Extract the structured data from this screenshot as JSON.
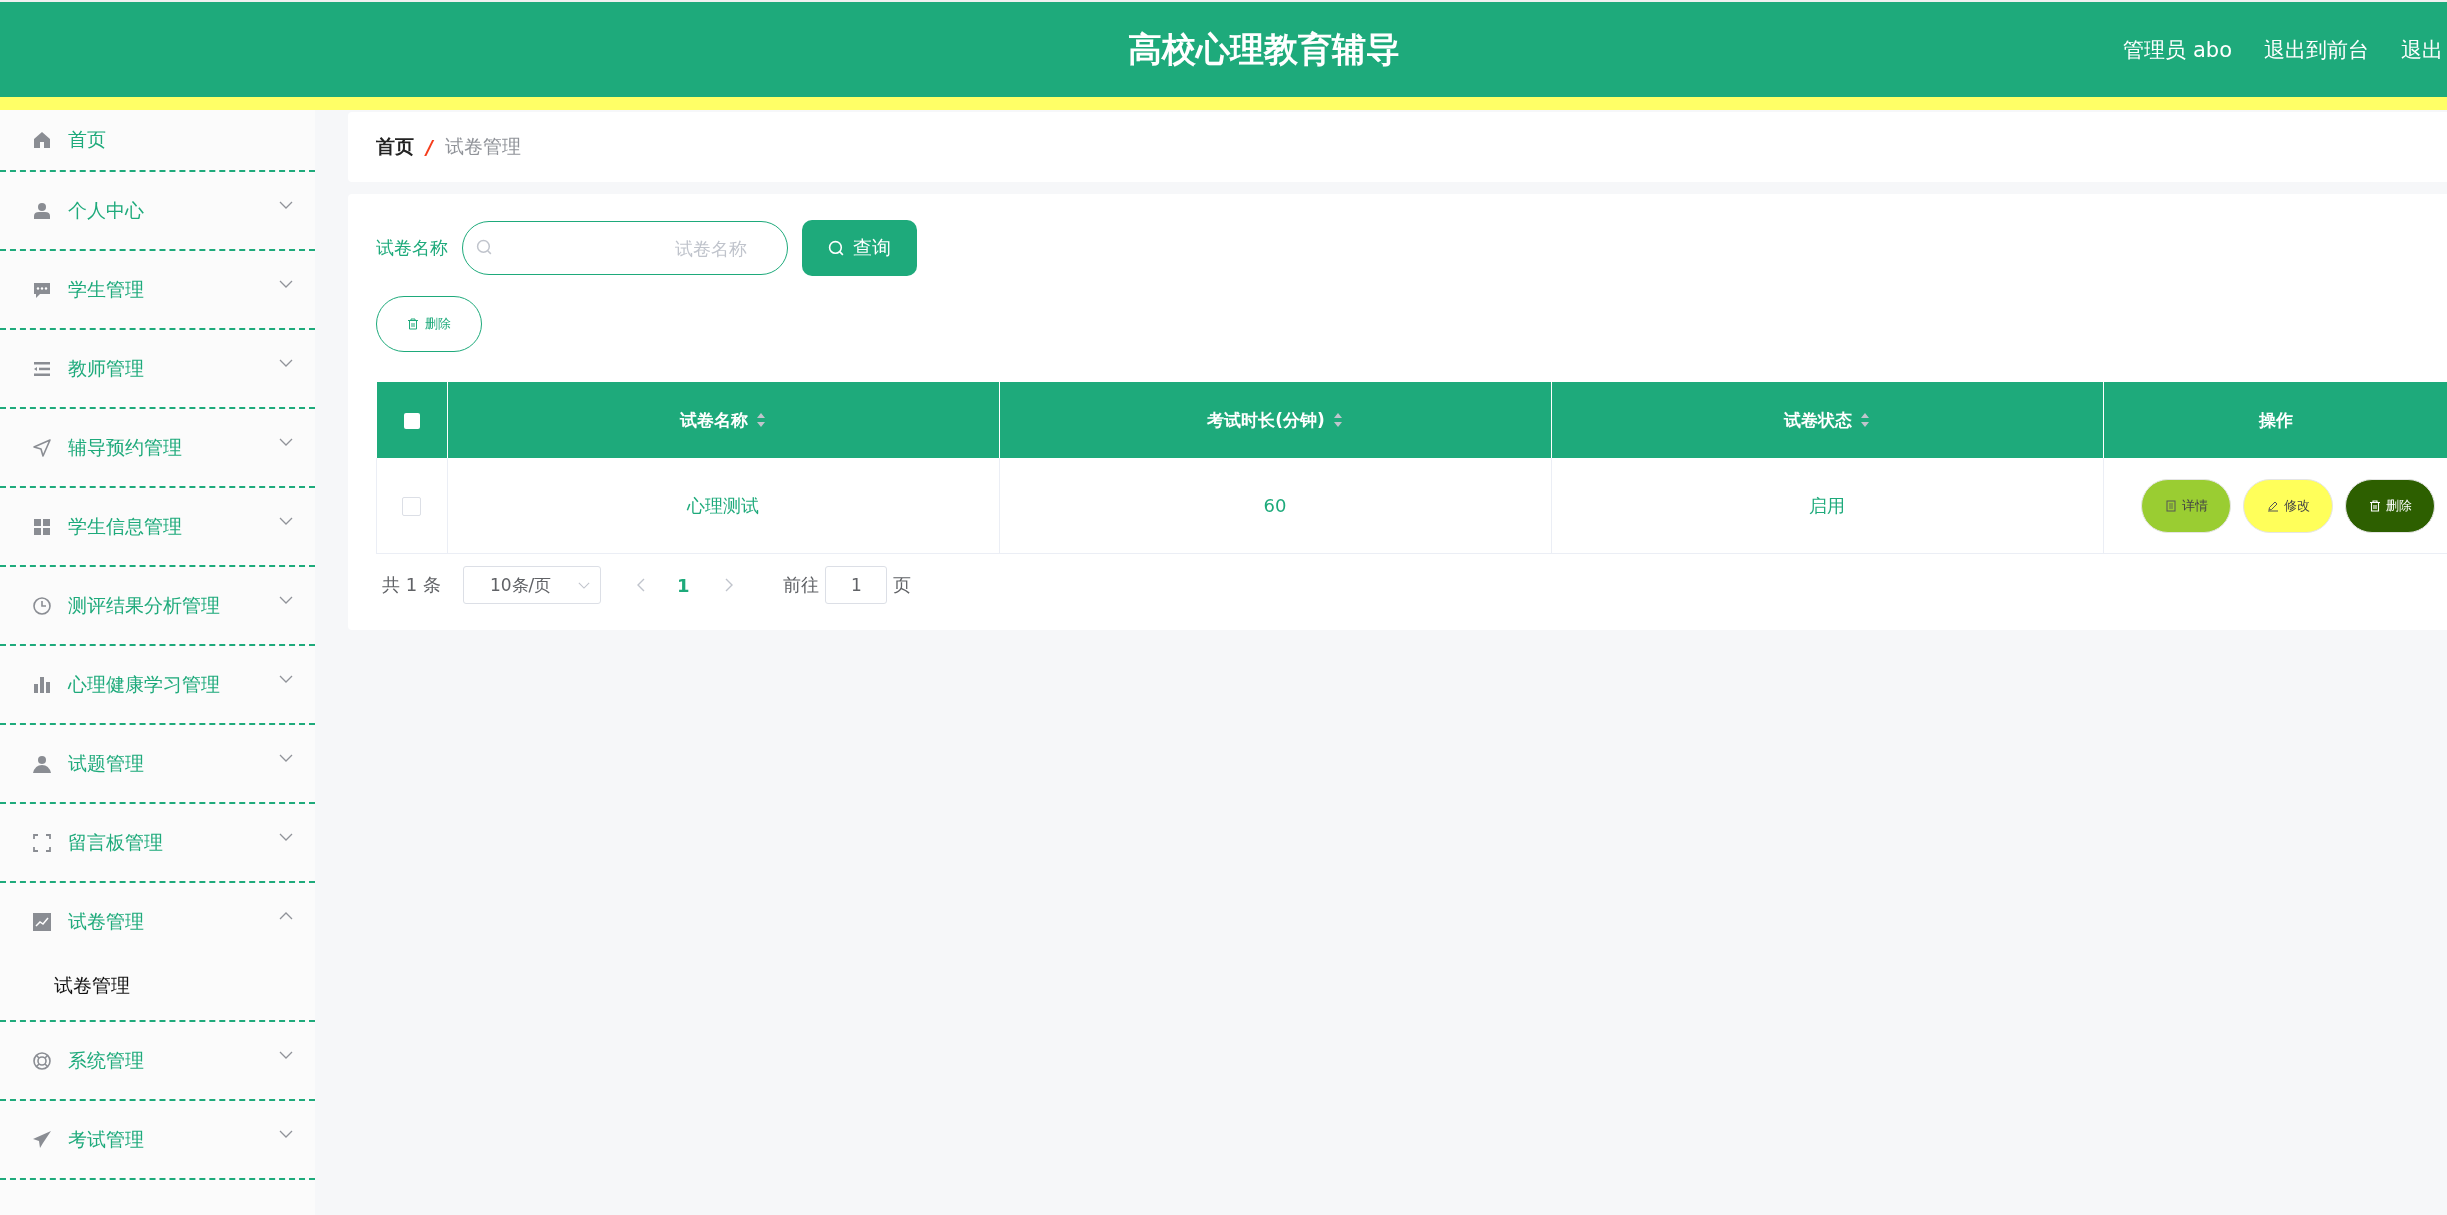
{
  "header": {
    "title": "高校心理教育辅导",
    "links": [
      "管理员 abo",
      "退出到前台",
      "退出"
    ]
  },
  "sidebar": {
    "items": [
      {
        "label": "首页",
        "kind": "link"
      },
      {
        "label": "个人中心",
        "kind": "group",
        "expanded": false
      },
      {
        "label": "学生管理",
        "kind": "group",
        "expanded": false
      },
      {
        "label": "教师管理",
        "kind": "group",
        "expanded": false
      },
      {
        "label": "辅导预约管理",
        "kind": "group",
        "expanded": false
      },
      {
        "label": "学生信息管理",
        "kind": "group",
        "expanded": false
      },
      {
        "label": "测评结果分析管理",
        "kind": "group",
        "expanded": false
      },
      {
        "label": "心理健康学习管理",
        "kind": "group",
        "expanded": false
      },
      {
        "label": "试题管理",
        "kind": "group",
        "expanded": false
      },
      {
        "label": "留言板管理",
        "kind": "group",
        "expanded": false
      },
      {
        "label": "试卷管理",
        "kind": "group",
        "expanded": true,
        "children": [
          {
            "label": "试卷管理",
            "selected": true
          }
        ]
      },
      {
        "label": "系统管理",
        "kind": "group",
        "expanded": false
      },
      {
        "label": "考试管理",
        "kind": "group",
        "expanded": false
      }
    ]
  },
  "breadcrumb": {
    "separator": "/",
    "items": [
      "首页",
      "试卷管理"
    ]
  },
  "search": {
    "label": "试卷名称",
    "placeholder": "试卷名称",
    "button": "查询"
  },
  "actions": {
    "delete": "删除"
  },
  "table": {
    "all_checked": false,
    "columns": [
      {
        "label": "试卷名称",
        "sortable": true
      },
      {
        "label": "考试时长(分钟)",
        "sortable": true
      },
      {
        "label": "试卷状态",
        "sortable": true
      },
      {
        "label": "操作",
        "sortable": false
      }
    ],
    "rows": [
      {
        "checked": false,
        "cells": [
          "心理测试",
          "60",
          "启用"
        ],
        "buttons": [
          {
            "kind": "detail",
            "label": "详情"
          },
          {
            "kind": "edit",
            "label": "修改"
          },
          {
            "kind": "delete",
            "label": "删除"
          }
        ]
      }
    ]
  },
  "pagination": {
    "total": "共 1 条",
    "page_size": "10条/页",
    "pages": [
      {
        "label": "1",
        "selected": true
      }
    ],
    "goto_label": "前往",
    "goto_value": "1",
    "goto_suffix": "页"
  }
}
